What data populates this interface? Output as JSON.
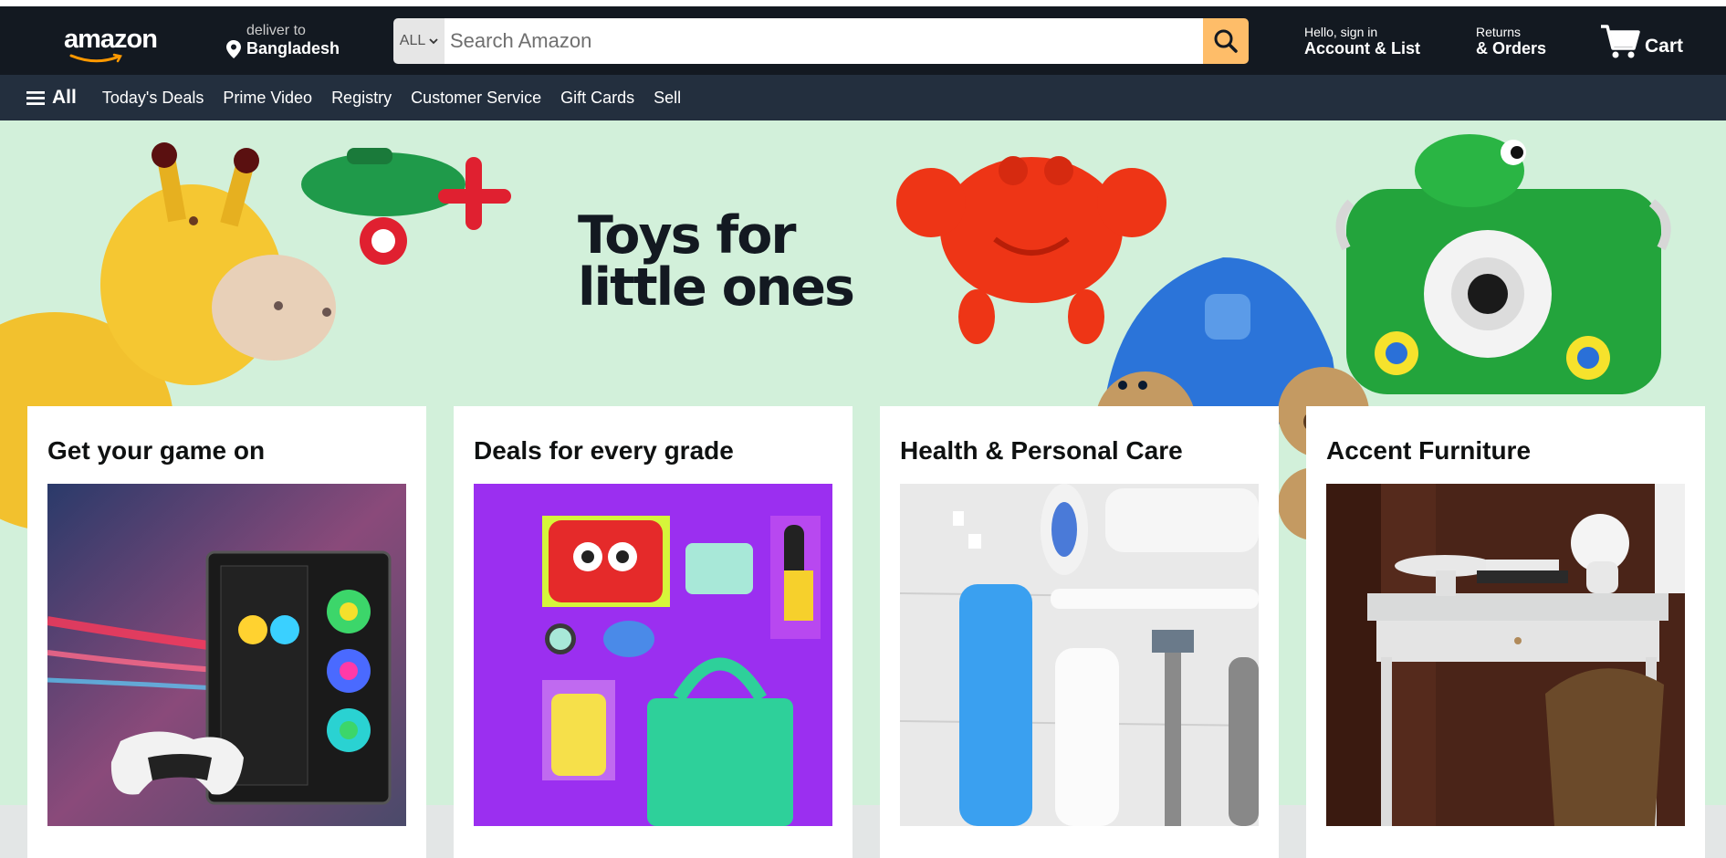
{
  "header": {
    "logo_text": "amazon",
    "deliver_label": "deliver to",
    "deliver_location": "Bangladesh",
    "search_category": "ALL",
    "search_placeholder": "Search Amazon",
    "account_greeting": "Hello, sign in",
    "account_label": "Account & List",
    "returns_label": "Returns",
    "orders_label": "& Orders",
    "cart_label": "Cart"
  },
  "subnav": {
    "all_label": "All",
    "items": [
      "Today's Deals",
      "Prime Video",
      "Registry",
      "Customer Service",
      "Gift Cards",
      "Sell"
    ]
  },
  "hero": {
    "title_line1": "Toys for",
    "title_line2": "little ones"
  },
  "cards": [
    {
      "title": "Get your game on",
      "image": "gaming-pc-and-controller"
    },
    {
      "title": "Deals for every grade",
      "image": "school-supplies-on-purple"
    },
    {
      "title": "Health & Personal Care",
      "image": "toiletries-on-wood"
    },
    {
      "title": "Accent Furniture",
      "image": "desk-and-chair"
    }
  ],
  "colors": {
    "nav_bg": "#131921",
    "subnav_bg": "#232f3e",
    "search_button": "#febd69",
    "hero_bg": "#d2f0da",
    "brand_orange": "#ff9900"
  }
}
